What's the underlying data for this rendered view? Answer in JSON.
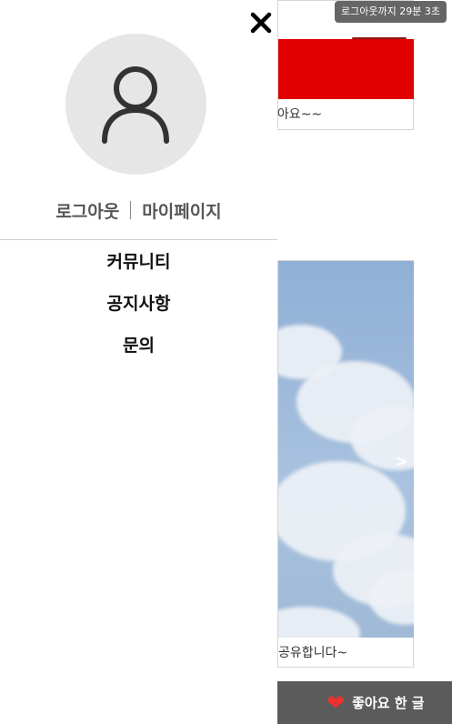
{
  "session": {
    "timer_text": "로그아웃까지 29분 3초"
  },
  "drawer": {
    "close_icon": "close-icon",
    "avatar_icon": "user-icon",
    "logout_label": "로그아웃",
    "mypage_label": "마이페이지",
    "menu_items": [
      {
        "label": "커뮤니티"
      },
      {
        "label": "공지사항"
      },
      {
        "label": "문의"
      }
    ]
  },
  "background": {
    "cards": [
      {
        "caption": "좋아요~~"
      },
      {
        "caption": "공유합니다~",
        "next_arrow": ">"
      }
    ],
    "like_bar": {
      "label": "좋아요 한 글",
      "icon": "heart-icon"
    }
  },
  "colors": {
    "drawer_bg": "#ffffff",
    "avatar_bg": "#e6e6e6",
    "timer_bg": "#666666",
    "like_bar_bg": "#5b5b5b",
    "heart": "#e8322f",
    "card_red": "#e00000"
  }
}
